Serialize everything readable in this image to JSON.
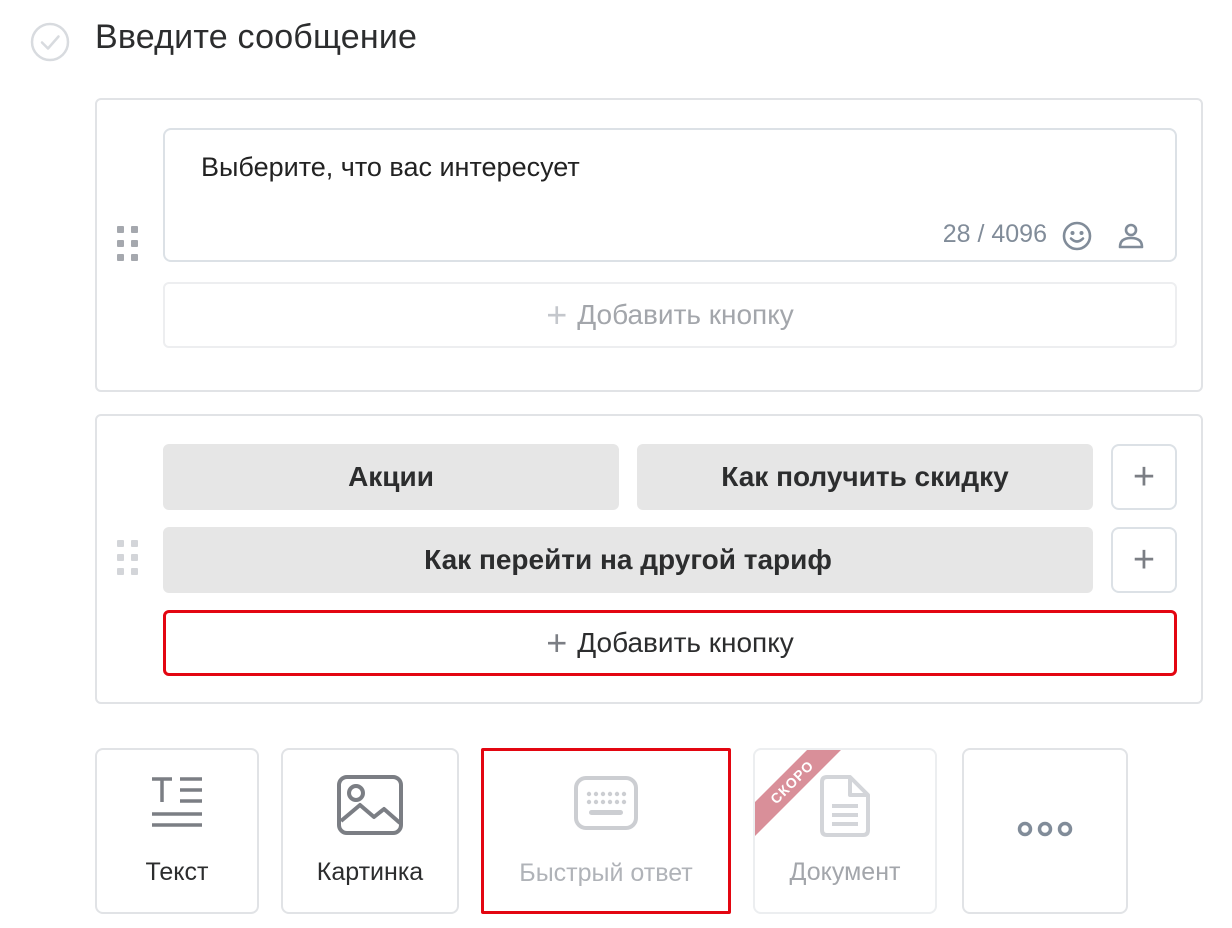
{
  "step": {
    "title": "Введите сообщение"
  },
  "message": {
    "text": "Выберите, что вас интересует",
    "counter": "28 / 4096",
    "add_button_label": "Добавить кнопку"
  },
  "keyboard": {
    "rows": [
      [
        "Акции",
        "Как получить скидку"
      ],
      [
        "Как перейти на другой тариф"
      ]
    ],
    "add_button_label": "Добавить кнопку",
    "add_plus": "+"
  },
  "toolbar": {
    "items": [
      {
        "label": "Текст",
        "icon": "text-icon"
      },
      {
        "label": "Картинка",
        "icon": "image-icon"
      },
      {
        "label": "Быстрый ответ",
        "icon": "keyboard-icon"
      },
      {
        "label": "Документ",
        "icon": "document-icon",
        "badge": "СКОРО"
      },
      {
        "label": "",
        "icon": "more-icon"
      }
    ]
  },
  "colors": {
    "highlight": "#e30611",
    "badge": "#d98f99",
    "button_bg": "#e6e6e6"
  }
}
